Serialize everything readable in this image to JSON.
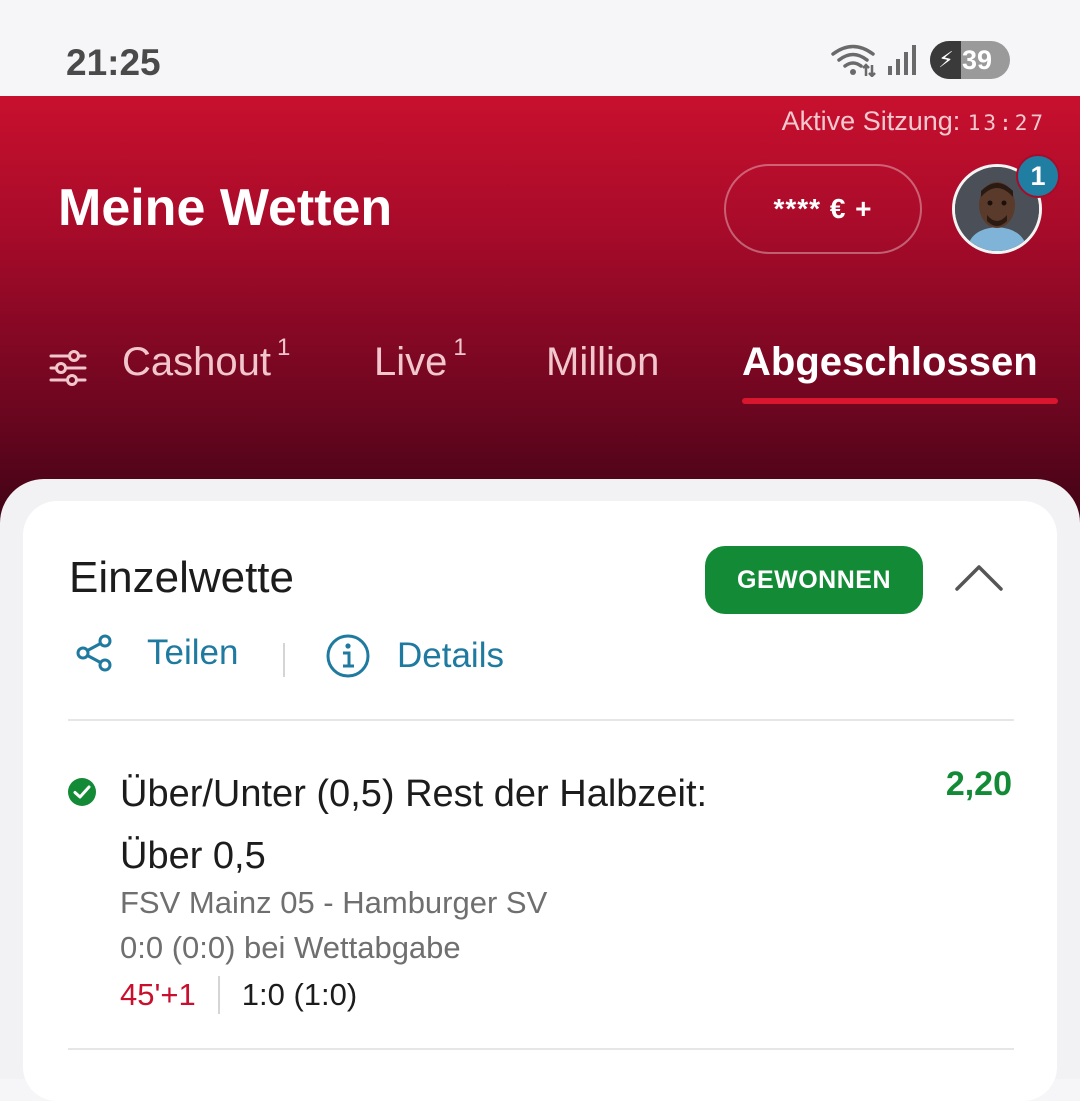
{
  "status_bar": {
    "time": "21:25",
    "battery_percent": "39",
    "battery_level": 0.39,
    "icons": [
      "wifi-icon",
      "signal-icon",
      "battery-icon"
    ]
  },
  "header": {
    "session_label": "Aktive Sitzung:",
    "session_timer": "13:27",
    "title": "Meine Wetten",
    "balance": "**** € +",
    "notification_count": "1"
  },
  "tabs": [
    {
      "label": "Cashout",
      "count": "1",
      "active": false
    },
    {
      "label": "Live",
      "count": "1",
      "active": false
    },
    {
      "label": "Million",
      "count": "",
      "active": false
    },
    {
      "label": "Abgeschlossen",
      "count": "",
      "active": true
    }
  ],
  "bet": {
    "type": "Einzelwette",
    "status": "GEWONNEN",
    "share_label": "Teilen",
    "details_label": "Details",
    "selection": {
      "market": "Über/Unter (0,5) Rest der Halbzeit:",
      "pick": "Über 0,5",
      "odds": "2,20",
      "match": "FSV Mainz 05 - Hamburger SV",
      "score_at_bet": "0:0 (0:0) bei Wettabgabe",
      "live_minute": "45'+1",
      "live_score": "1:0 (1:0)"
    }
  },
  "colors": {
    "brand_red": "#c8102e",
    "won_green": "#138a36",
    "link_blue": "#1f7aa0"
  }
}
